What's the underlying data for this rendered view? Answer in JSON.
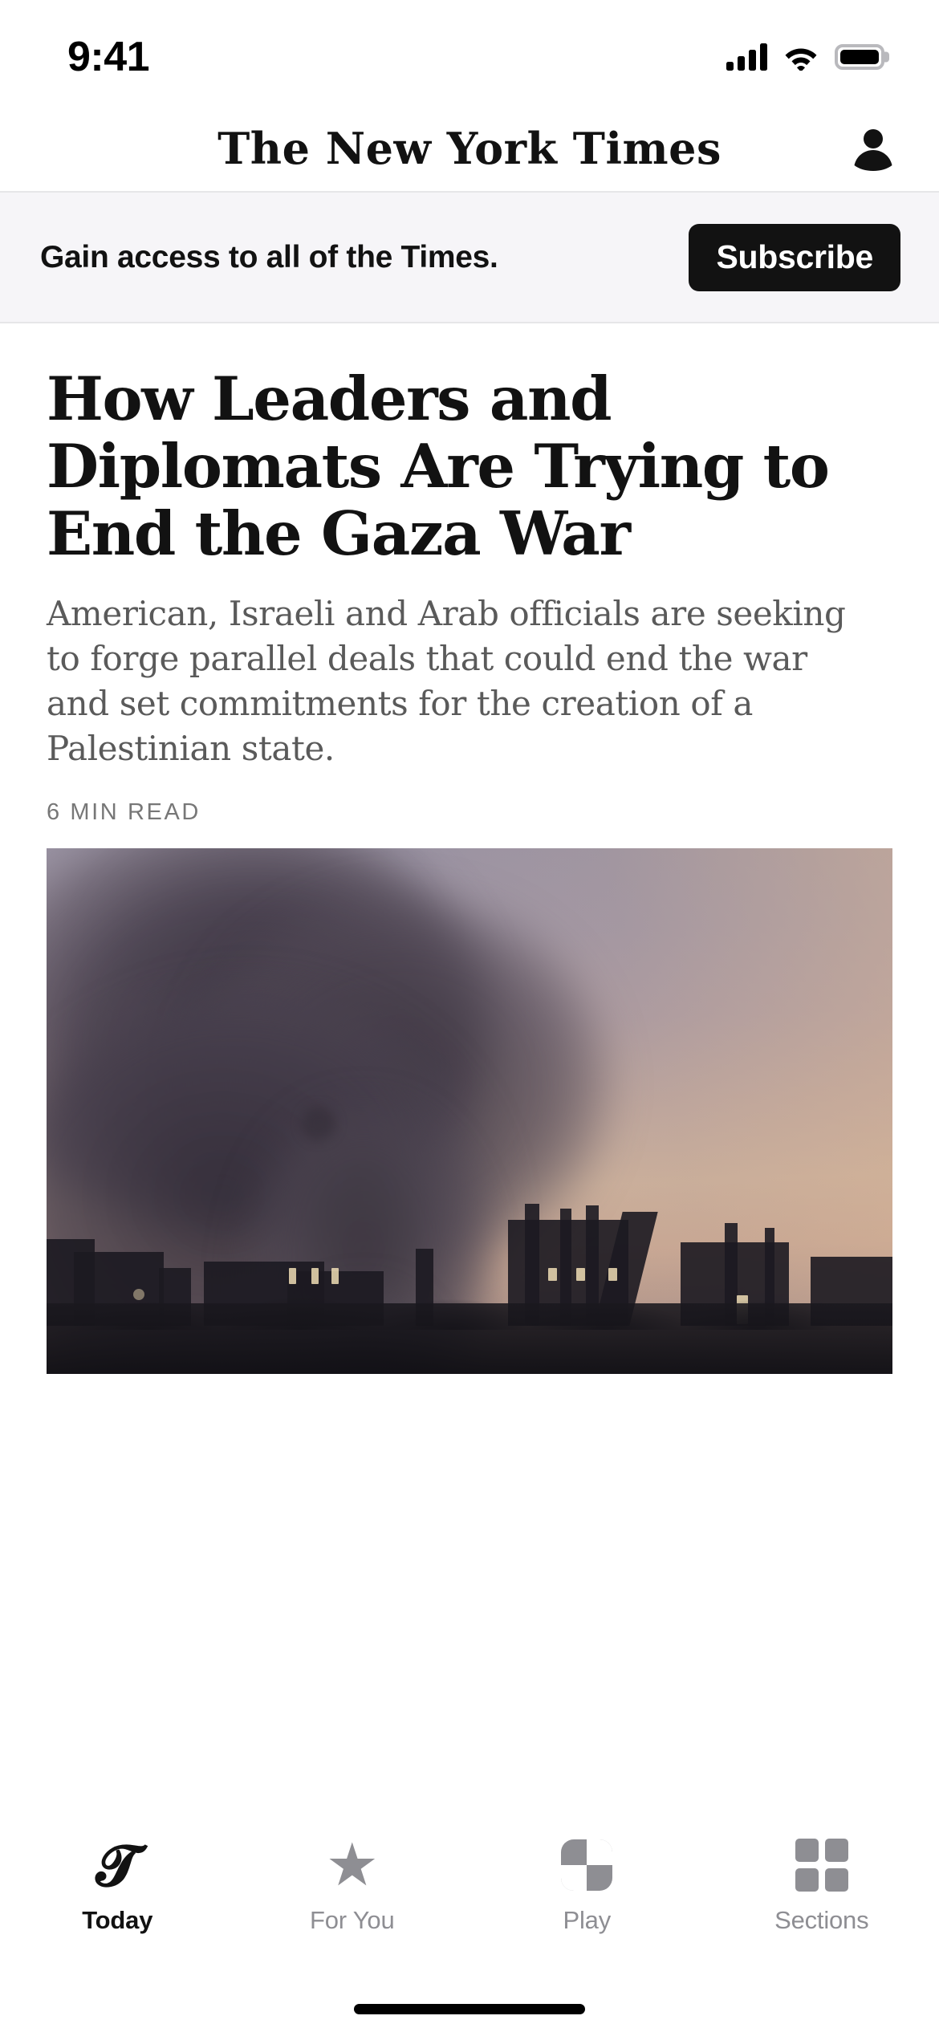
{
  "status_bar": {
    "time": "9:41",
    "cellular_icon": "signal-bars-icon",
    "wifi_icon": "wifi-icon",
    "battery_icon": "battery-full-icon"
  },
  "header": {
    "masthead": "The New York Times",
    "account_icon": "account-person-icon"
  },
  "subscribe_banner": {
    "message": "Gain access to all of the Times.",
    "button_label": "Subscribe",
    "background_color": "#f6f5f8",
    "button_color": "#121212"
  },
  "article": {
    "headline": "How Leaders and Diplomats Are Trying to End the Gaza War",
    "summary": "American, Israeli and Arab officials are seeking to forge parallel deals that could end the war and set commitments for the creation of a Palestinian state.",
    "read_time": "6 MIN READ",
    "photo_alt": "Smoke rising over a city skyline at dusk"
  },
  "tab_bar": {
    "tabs": [
      {
        "label": "Today",
        "icon": "nyt-t-logo-icon",
        "active": true
      },
      {
        "label": "For You",
        "icon": "star-icon",
        "active": false
      },
      {
        "label": "Play",
        "icon": "play-checkerboard-icon",
        "active": false
      },
      {
        "label": "Sections",
        "icon": "grid-squares-icon",
        "active": false
      }
    ],
    "active_color": "#121212",
    "inactive_color": "#8e8e93"
  }
}
